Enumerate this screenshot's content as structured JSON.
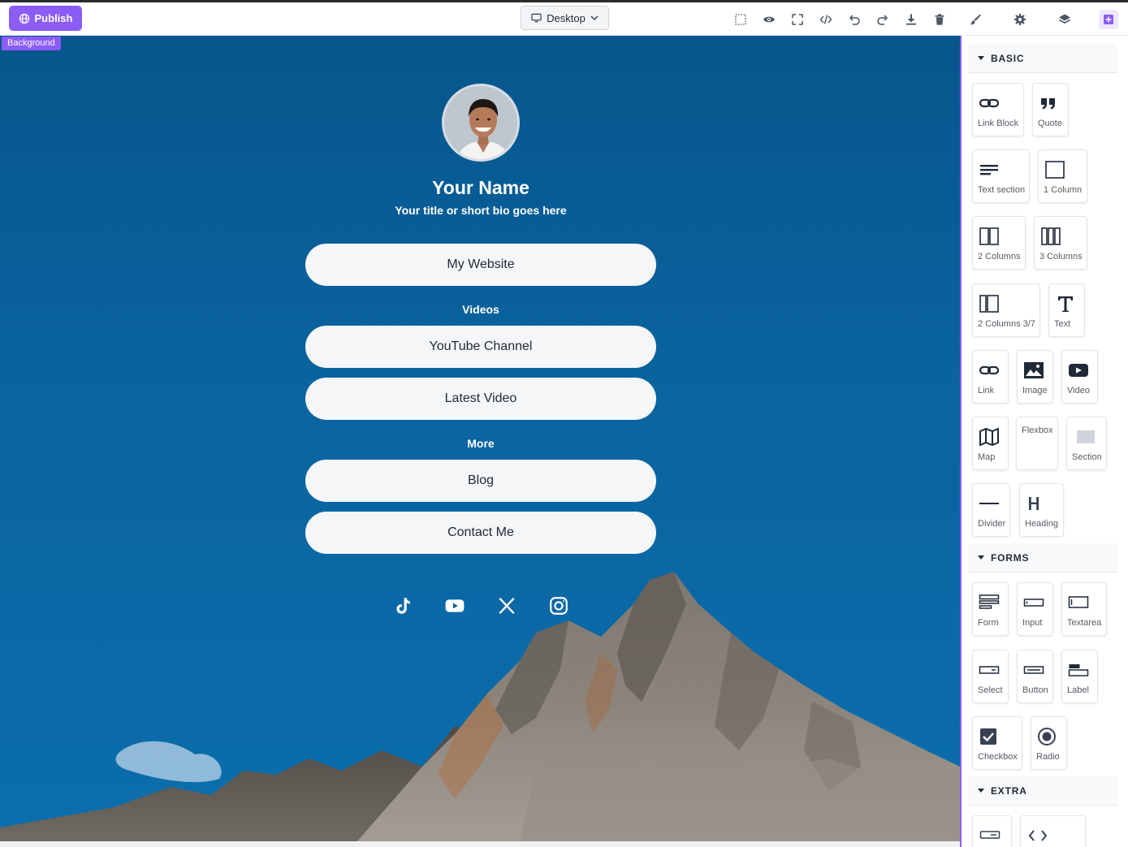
{
  "toolbar": {
    "publish_label": "Publish",
    "device_label": "Desktop",
    "tools": [
      "select-outline-icon",
      "preview-eye-icon",
      "fullscreen-icon",
      "code-icon",
      "undo-icon",
      "redo-icon",
      "download-icon",
      "trash-icon"
    ],
    "panel_tabs": [
      "brush-icon",
      "gear-icon",
      "layers-icon",
      "blocks-plus-icon"
    ],
    "accent": "#8b5cf6"
  },
  "canvas": {
    "selected_label": "Background",
    "profile": {
      "name": "Your Name",
      "bio": "Your title or short bio goes here"
    },
    "links": {
      "my_website": "My Website",
      "videos_heading": "Videos",
      "youtube_channel": "YouTube Channel",
      "latest_video": "Latest Video",
      "more_heading": "More",
      "blog": "Blog",
      "contact_me": "Contact Me"
    },
    "socials": [
      "tiktok-icon",
      "youtube-icon",
      "x-icon",
      "instagram-icon"
    ]
  },
  "panel": {
    "categories": {
      "basic": "BASIC",
      "forms": "FORMS",
      "extra": "EXTRA"
    },
    "basic": {
      "link_block": "Link Block",
      "quote": "Quote",
      "text_section": "Text section",
      "one_column": "1 Column",
      "two_columns": "2 Columns",
      "three_columns": "3 Columns",
      "two_columns_37": "2 Columns 3/7",
      "text": "Text",
      "link": "Link",
      "image": "Image",
      "video": "Video",
      "map": "Map",
      "flexbox": "Flexbox",
      "section": "Section",
      "divider": "Divider",
      "heading": "Heading"
    },
    "forms": {
      "form": "Form",
      "input": "Input",
      "textarea": "Textarea",
      "select": "Select",
      "button": "Button",
      "label": "Label",
      "checkbox": "Checkbox",
      "radio": "Radio"
    }
  }
}
